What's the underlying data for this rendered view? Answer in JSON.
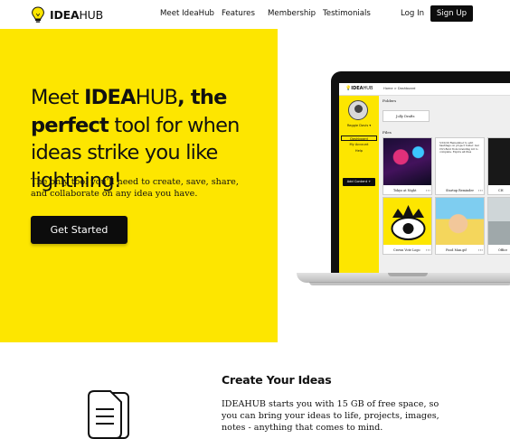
{
  "nav": {
    "logo": {
      "bold": "IDEA",
      "light": "HUB",
      "icon": "lightbulb-icon"
    },
    "links": [
      "Meet IdeaHub",
      "Features",
      "Membership",
      "Testimonials"
    ],
    "login": "Log In",
    "signup": "Sign Up"
  },
  "hero": {
    "title_pre": "Meet ",
    "title_brand_bold": "IDEA",
    "title_brand_light": "HUB",
    "title_bold": ", the perfect",
    "title_rest": "tool for when ideas strike you like lightning!",
    "subtitle": "The only tool you'll need to create, save, share, and collaborate on any idea you have.",
    "cta": "Get Started",
    "background": "#fde600"
  },
  "mockup": {
    "logo_bold": "IDEA",
    "logo_light": "HUB",
    "breadcrumb": "Home > Dashboard",
    "user": "Reggie Davis ▾",
    "nav": [
      "Dashboard",
      "My Account",
      "Help"
    ],
    "add_button": "Add Content +",
    "folders_heading": "Folders",
    "folder": "Jolly Drafts",
    "files_heading": "Files",
    "note_text": "5/10/20 Remember to edit hashtags on project folder. Get Ctrl-Bold from branding kit to complete. Expire all files",
    "files": [
      "Tokyo at Night",
      "Startup Reminder",
      "CH",
      "Crown Vote Logo",
      "Food Man.gif",
      "Office"
    ]
  },
  "section": {
    "title": "Create Your Ideas",
    "text": "IDEAHUB starts you with 15 GB of free space, so you can bring your ideas to life, projects, images, notes - anything that comes to mind.",
    "icon": "document-stack-icon"
  }
}
